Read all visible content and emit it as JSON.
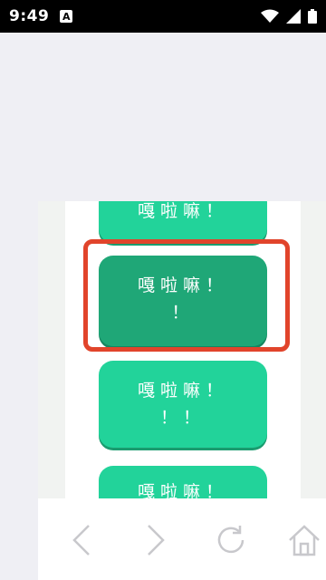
{
  "status_bar": {
    "time": "9:49",
    "notification_icon": "A"
  },
  "cards": [
    {
      "line1": "嘎啦嘛！",
      "line2": ""
    },
    {
      "line1": "嘎啦嘛！",
      "line2": "！"
    },
    {
      "line1": "嘎啦嘛！",
      "line2": "！！"
    },
    {
      "line1": "嘎啦嘛！",
      "line2": ""
    }
  ],
  "nav": {
    "back_icon": "chevron-left-icon",
    "forward_icon": "chevron-right-icon",
    "refresh_icon": "refresh-icon",
    "home_icon": "home-icon"
  },
  "colors": {
    "card": "#22d39a",
    "card_selected": "#1fa777",
    "highlight": "#e1442b"
  }
}
